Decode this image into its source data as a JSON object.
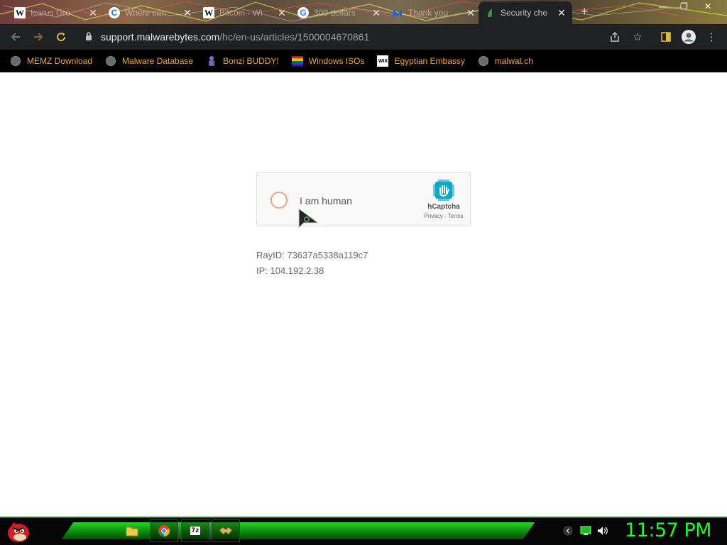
{
  "tabs": [
    {
      "favicon": "wikipedia-icon",
      "title": "Icarus Gro",
      "active": false
    },
    {
      "favicon": "c-icon",
      "title": "Where can",
      "active": false
    },
    {
      "favicon": "wikipedia-icon",
      "title": "Bitcoin - Wi",
      "active": false
    },
    {
      "favicon": "google-icon",
      "title": "300 dollars",
      "active": false
    },
    {
      "favicon": "malwarebytes-icon",
      "title": "Thank you",
      "active": false
    },
    {
      "favicon": "security-icon",
      "title": "Security che",
      "active": true
    }
  ],
  "address_bar": {
    "domain": "support.malwarebytes.com",
    "path": "/hc/en-us/articles/1500004670861"
  },
  "bookmarks": [
    {
      "icon": "globe-icon",
      "label": "MEMZ Download"
    },
    {
      "icon": "globe-icon",
      "label": "Malware Database"
    },
    {
      "icon": "bonzi-icon",
      "label": "Bonzi BUDDY!"
    },
    {
      "icon": "windows-flag-icon",
      "label": "Windows ISOs"
    },
    {
      "icon": "wix-icon",
      "label": "Egyptian Embassy"
    },
    {
      "icon": "globe-icon",
      "label": "malwat.ch"
    }
  ],
  "captcha": {
    "label": "I am human",
    "brand": "hCaptcha",
    "links": "Privacy - Terms"
  },
  "ray_id": "RayID: 73637a5338a119c7",
  "ip": "IP: 104.192.2.38",
  "taskbar": {
    "apps": [
      "folder-icon",
      "chrome-icon",
      "7zip-icon",
      "handshake-icon"
    ],
    "clock": "11:57 PM"
  },
  "colors": {
    "accent_orange": "#f5a623",
    "clock_green": "#1cff2a",
    "taskbar_green": "#1fbf1f"
  }
}
